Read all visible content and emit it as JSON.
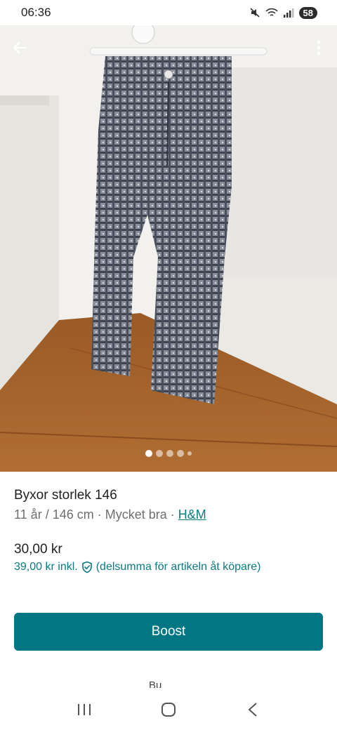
{
  "status_bar": {
    "time": "06:36",
    "battery": "58"
  },
  "photo": {
    "alt": ""
  },
  "carousel": {
    "total": 5,
    "active": 0
  },
  "item": {
    "title": "Byxor storlek 146",
    "details": "11 år / 146 cm · Mycket bra · ",
    "brand": "H&M",
    "price": "30,00 kr",
    "price_incl": "39,00 kr  inkl.",
    "price_incl_note": "(delsumma för artikeln åt köpare)"
  },
  "actions": {
    "boost_label": "Boost",
    "partial_label": "Bu"
  },
  "icons": {
    "back": "arrow-left-icon",
    "more": "more-vertical-icon",
    "shield": "shield-check-icon",
    "recents": "recents-icon",
    "home": "home-icon",
    "nav_back": "nav-back-icon"
  },
  "colors": {
    "accent": "#007782",
    "link": "#0b7b83"
  }
}
